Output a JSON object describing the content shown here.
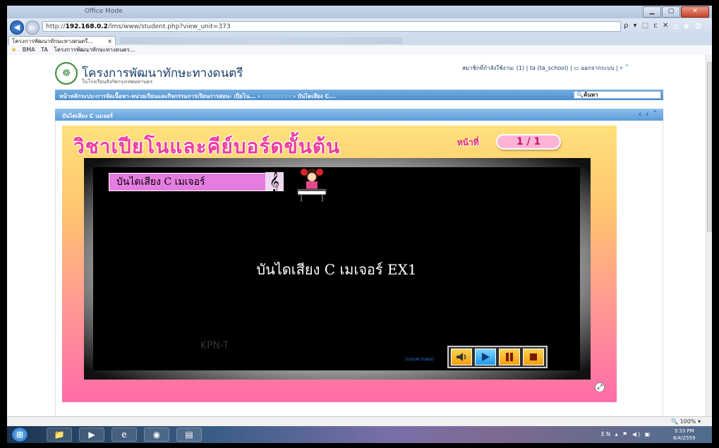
{
  "browser": {
    "window_title": "Office Mode",
    "url_prefix": "http://",
    "url_host": "192.168.0.2",
    "url_path": "/lms/www/student.php?view_unit=373",
    "addr_controls": "ρ ▾ ⬚ c ✕",
    "tab_title": "โครงการพัฒนาทักษะทางดนตรี...",
    "tab_close": "×",
    "favorites": [
      "BMA",
      "TA",
      "โครงการพัฒนาทักษะทางดนตร..."
    ],
    "zoom": "100%"
  },
  "site": {
    "title": "โครงการพัฒนาทักษะทางดนตรี",
    "subtitle": "ในโรงเรียนสังกัดกรุงเทพมหานคร",
    "user_status": "สมาชิกที่กำลังใช้งาน: (1) | ta (ta_school) |",
    "logout": "ออกจากระบบ |",
    "menu_path": "หน้าหลักระบบ›การจัดเนื้อหา-หน่วยเรียนและกิจกรรมการเรียนการสอน› เปียโน... ›",
    "menu_hidden": "xxxxxxxx",
    "menu_last": "› บันไดเสียง C...",
    "search_label": "ค้นหา",
    "panel_title": "บันไดเสียง C เมเจอร์"
  },
  "lesson": {
    "course_title": "วิชาเปียโนและคีย์บอร์ดขั้นต้น",
    "page_label": "หน้าที่",
    "page_value": "1 / 1",
    "section_label": "บันไดเสียง C เมเจอร์",
    "content_text": "บันไดเสียง C เมเจอร์ EX1",
    "watermark": "KPN-T",
    "hint": "(แถบควบคุม)",
    "fullscreen": "⤢"
  },
  "taskbar": {
    "lang": "EN",
    "time": "3:33 PM",
    "date": "6/4/2559"
  },
  "colors": {
    "accent_blue": "#4d8fd0",
    "title_pink": "#f03a9c",
    "control_orange": "#f2a10e",
    "control_blue": "#1f9ae8"
  }
}
